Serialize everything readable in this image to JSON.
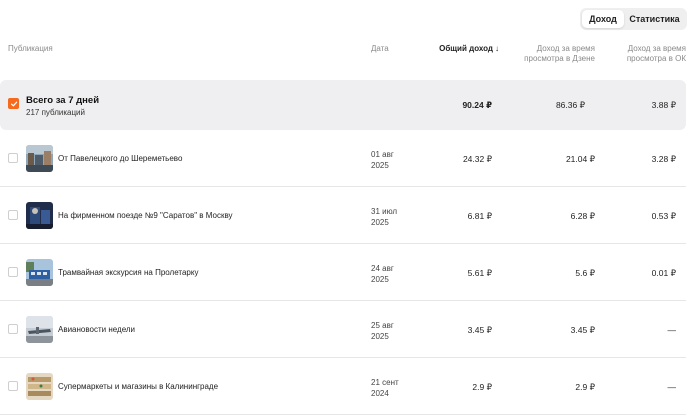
{
  "tabs": {
    "income": "Доход",
    "stats": "Статистика"
  },
  "columns": {
    "publication": "Публикация",
    "date": "Дата",
    "total": "Общий доход",
    "dzen_l1": "Доход за время",
    "dzen_l2": "просмотра в Дзене",
    "ok_l1": "Доход за время",
    "ok_l2": "просмотра в ОК"
  },
  "summary": {
    "title": "Всего за 7 дней",
    "subtitle": "217 публикаций",
    "total": "90.24 ₽",
    "dzen": "86.36 ₽",
    "ok": "3.88 ₽"
  },
  "rows": [
    {
      "title": "От Павелецкого до Шереметьево",
      "date1": "01 авг",
      "date2": "2025",
      "total": "24.32 ₽",
      "dzen": "21.04 ₽",
      "ok": "3.28 ₽"
    },
    {
      "title": "На фирменном поезде №9 \"Саратов\" в Москву",
      "date1": "31 июл",
      "date2": "2025",
      "total": "6.81 ₽",
      "dzen": "6.28 ₽",
      "ok": "0.53 ₽"
    },
    {
      "title": "Трамвайная экскурсия на Пролетарку",
      "date1": "24 авг",
      "date2": "2025",
      "total": "5.61 ₽",
      "dzen": "5.6 ₽",
      "ok": "0.01 ₽"
    },
    {
      "title": "Авиановости недели",
      "date1": "25 авг",
      "date2": "2025",
      "total": "3.45 ₽",
      "dzen": "3.45 ₽",
      "ok": "—"
    },
    {
      "title": "Супермаркеты и магазины в Калининграде",
      "date1": "21 сент",
      "date2": "2024",
      "total": "2.9 ₽",
      "dzen": "2.9 ₽",
      "ok": "—"
    }
  ],
  "colors": {
    "accent": "#f56a1c",
    "summary_bg": "#efeff1"
  }
}
